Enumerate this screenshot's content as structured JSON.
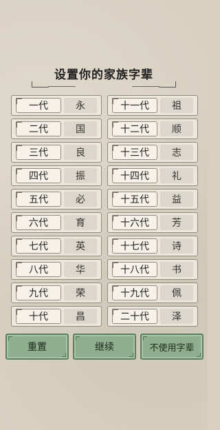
{
  "title": "设置你的家族字辈",
  "generations": [
    {
      "gen": "一代",
      "char": "永"
    },
    {
      "gen": "十一代",
      "char": "祖"
    },
    {
      "gen": "二代",
      "char": "国"
    },
    {
      "gen": "十二代",
      "char": "顺"
    },
    {
      "gen": "三代",
      "char": "良"
    },
    {
      "gen": "十三代",
      "char": "志"
    },
    {
      "gen": "四代",
      "char": "振"
    },
    {
      "gen": "十四代",
      "char": "礼"
    },
    {
      "gen": "五代",
      "char": "必"
    },
    {
      "gen": "十五代",
      "char": "益"
    },
    {
      "gen": "六代",
      "char": "育"
    },
    {
      "gen": "十六代",
      "char": "芳"
    },
    {
      "gen": "七代",
      "char": "英"
    },
    {
      "gen": "十七代",
      "char": "诗"
    },
    {
      "gen": "八代",
      "char": "华"
    },
    {
      "gen": "十八代",
      "char": "书"
    },
    {
      "gen": "九代",
      "char": "荣"
    },
    {
      "gen": "十九代",
      "char": "佩"
    },
    {
      "gen": "十代",
      "char": "昌"
    },
    {
      "gen": "二十代",
      "char": "泽"
    }
  ],
  "buttons": {
    "reset": "重置",
    "continue": "继续",
    "skip": "不使用字辈"
  },
  "colors": {
    "background": "#d8d1c2",
    "button_green": "#8fae8d"
  }
}
